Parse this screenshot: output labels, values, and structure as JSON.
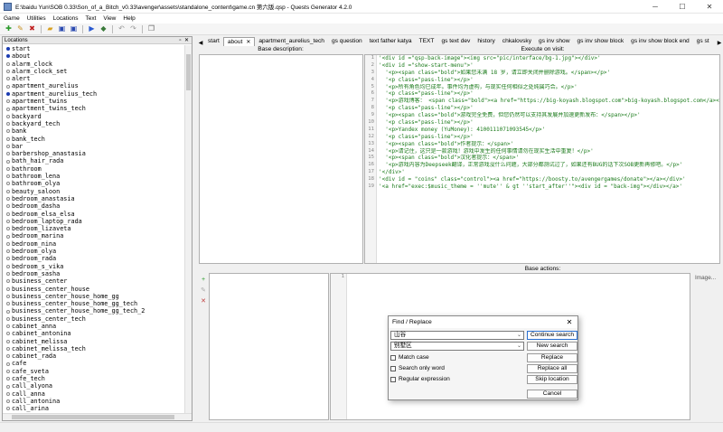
{
  "window": {
    "title": "E:\\baidu Yun\\SOB 0.33\\Son_of_a_Bitch_v0.33\\avenger\\assets\\standalone_content\\game.cn 第六版.qsp - Quests Generator 4.2.0",
    "minimize": "─",
    "maximize": "☐",
    "close": "✕"
  },
  "menu": [
    "Game",
    "Utilities",
    "Locations",
    "Text",
    "View",
    "Help"
  ],
  "locations_panel": {
    "title": "Locations",
    "float_btn": "▫",
    "close_btn": "✕",
    "items": [
      {
        "name": "start",
        "filled": true
      },
      {
        "name": "about",
        "filled": true
      },
      {
        "name": "alarm_clock",
        "filled": false
      },
      {
        "name": "alarm_clock_set",
        "filled": false
      },
      {
        "name": "alert",
        "filled": false
      },
      {
        "name": "apartment_aurelius",
        "filled": false
      },
      {
        "name": "apartment_aurelius_tech",
        "filled": true
      },
      {
        "name": "apartment_twins",
        "filled": false
      },
      {
        "name": "apartment_twins_tech",
        "filled": false
      },
      {
        "name": "backyard",
        "filled": false
      },
      {
        "name": "backyard_tech",
        "filled": false
      },
      {
        "name": "bank",
        "filled": false
      },
      {
        "name": "bank_tech",
        "filled": false
      },
      {
        "name": "bar",
        "filled": false
      },
      {
        "name": "barbershop_anastasia",
        "filled": false
      },
      {
        "name": "bath_hair_rada",
        "filled": false
      },
      {
        "name": "bathroom",
        "filled": false
      },
      {
        "name": "bathroom_lena",
        "filled": false
      },
      {
        "name": "bathroom_olya",
        "filled": false
      },
      {
        "name": "beauty_saloon",
        "filled": false
      },
      {
        "name": "bedroom_anastasia",
        "filled": false
      },
      {
        "name": "bedroom_dasha",
        "filled": false
      },
      {
        "name": "bedroom_elsa_elsa",
        "filled": false
      },
      {
        "name": "bedroom_laptop_rada",
        "filled": false
      },
      {
        "name": "bedroom_lizaveta",
        "filled": false
      },
      {
        "name": "bedroom_marina",
        "filled": false
      },
      {
        "name": "bedroom_nina",
        "filled": false
      },
      {
        "name": "bedroom_olya",
        "filled": false
      },
      {
        "name": "bedroom_rada",
        "filled": false
      },
      {
        "name": "bedroom_s_vika",
        "filled": false
      },
      {
        "name": "bedroom_sasha",
        "filled": false
      },
      {
        "name": "business_center",
        "filled": false
      },
      {
        "name": "business_center_house",
        "filled": false
      },
      {
        "name": "business_center_house_home_gg",
        "filled": false
      },
      {
        "name": "business_center_house_home_gg_tech",
        "filled": false
      },
      {
        "name": "business_center_house_home_gg_tech_2",
        "filled": false
      },
      {
        "name": "business_center_tech",
        "filled": false
      },
      {
        "name": "cabinet_anna",
        "filled": false
      },
      {
        "name": "cabinet_antonina",
        "filled": false
      },
      {
        "name": "cabinet_melissa",
        "filled": false
      },
      {
        "name": "cabinet_melissa_tech",
        "filled": false
      },
      {
        "name": "cabinet_rada",
        "filled": false
      },
      {
        "name": "cafe",
        "filled": false
      },
      {
        "name": "cafe_sveta",
        "filled": false
      },
      {
        "name": "cafe_tech",
        "filled": false
      },
      {
        "name": "call_alyona",
        "filled": false
      },
      {
        "name": "call_anna",
        "filled": false
      },
      {
        "name": "call_antonina",
        "filled": false
      },
      {
        "name": "call_arina",
        "filled": false
      }
    ]
  },
  "tabs": [
    {
      "label": "start",
      "active": false
    },
    {
      "label": "about",
      "active": true,
      "close": "✕"
    },
    {
      "label": "apartment_aurelius_tech",
      "active": false
    },
    {
      "label": "gs question",
      "active": false
    },
    {
      "label": "text father katya",
      "active": false
    },
    {
      "label": "TEXT",
      "active": false
    },
    {
      "label": "gs text dev",
      "active": false
    },
    {
      "label": "history",
      "active": false
    },
    {
      "label": "chkalovsky",
      "active": false
    },
    {
      "label": "gs inv show",
      "active": false
    },
    {
      "label": "gs inv show block",
      "active": false
    },
    {
      "label": "gs inv show block end",
      "active": false
    },
    {
      "label": "gs st",
      "active": false
    }
  ],
  "tab_arrows": {
    "left": "◀",
    "right": "▶"
  },
  "editor": {
    "base_description_label": "Base description:",
    "execute_on_visit_label": "Execute on visit:",
    "base_actions_label": "Base actions:",
    "image_button": "Image...",
    "visit_code": [
      "'<div id =\"qsp-back-image\"><img src=\"pic/interface/bg-1.jpg\"></div>'",
      "'<div id =\"show-start-menu\">'",
      "  '<p><span class=\"bold\">如果您未满 18 岁，请立即关闭并删除游戏。</span></p>'",
      "  '<p class=\"pass-line\"></p>'",
      "  '<p>所有角色均已成年。事件均为虚构，与现实任何相似之处纯属巧合。</p>'",
      "  '<p class=\"pass-line\"></p>'",
      "  '<p>游戏博客： <span class=\"bold\"><a href=\"https://big-koyash.blogspot.com\">big-koyash.blogspot.com</a></span></p>'",
      "  '<p class=\"pass-line\"></p>'",
      "  '<p><span class=\"bold\">游戏完全免费，但您仍然可以支持其发展并加速更新发布：</span></p>'",
      "  '<p class=\"pass-line\"></p>'",
      "  '<p>Yandex money (YuMoney): 4100111071093545</p>'",
      "  '<p class=\"pass-line\"></p>'",
      "  '<p><span class=\"bold\">作者提示：</span>'",
      "  '<p>请记住，这只是一款游戏！游戏中发生的任何事情请勿在现实生活中重复！</p>'",
      "  '<p><span class=\"bold\">汉化者提示：</span>'",
      "  '<p>游戏内容为Deepseek翻译，正常游戏没什么问题，大部分都测试过了，如果还有BUG的话下次SOB更新再修吧。</p>'",
      "'</div>'",
      "'<div id = \"coins\" class=\"control\"><a href=\"https://boosty.to/avengergames/donate\"></a></div>'",
      "'<a href=\"exec:$music_theme = ''mute'' & gt ''start_after''\"><div id = \"back-img\"></div></a>'"
    ],
    "actions_tools": [
      "+",
      "✎",
      "✕"
    ],
    "action_code_first_line": "1"
  },
  "find_dialog": {
    "title": "Find / Replace",
    "close": "✕",
    "search_value": "山谷",
    "replace_value": "别墅区",
    "dropdown_arrow": "⌄",
    "buttons": {
      "continue_search": "Continue search",
      "new_search": "New search",
      "replace": "Replace",
      "replace_all": "Replace all",
      "skip_location": "Skip location",
      "cancel": "Cancel"
    },
    "checkboxes": {
      "match_case": "Match case",
      "search_only_word": "Search only word",
      "regular_expression": "Regular expression"
    }
  },
  "toolbar_icons": [
    "new-location-icon",
    "rename-icon",
    "delete-icon",
    "open-icon",
    "save-icon",
    "save-as-icon",
    "run-game-icon",
    "run-tests-icon",
    "undo-icon",
    "redo-icon",
    "copy-icon"
  ]
}
